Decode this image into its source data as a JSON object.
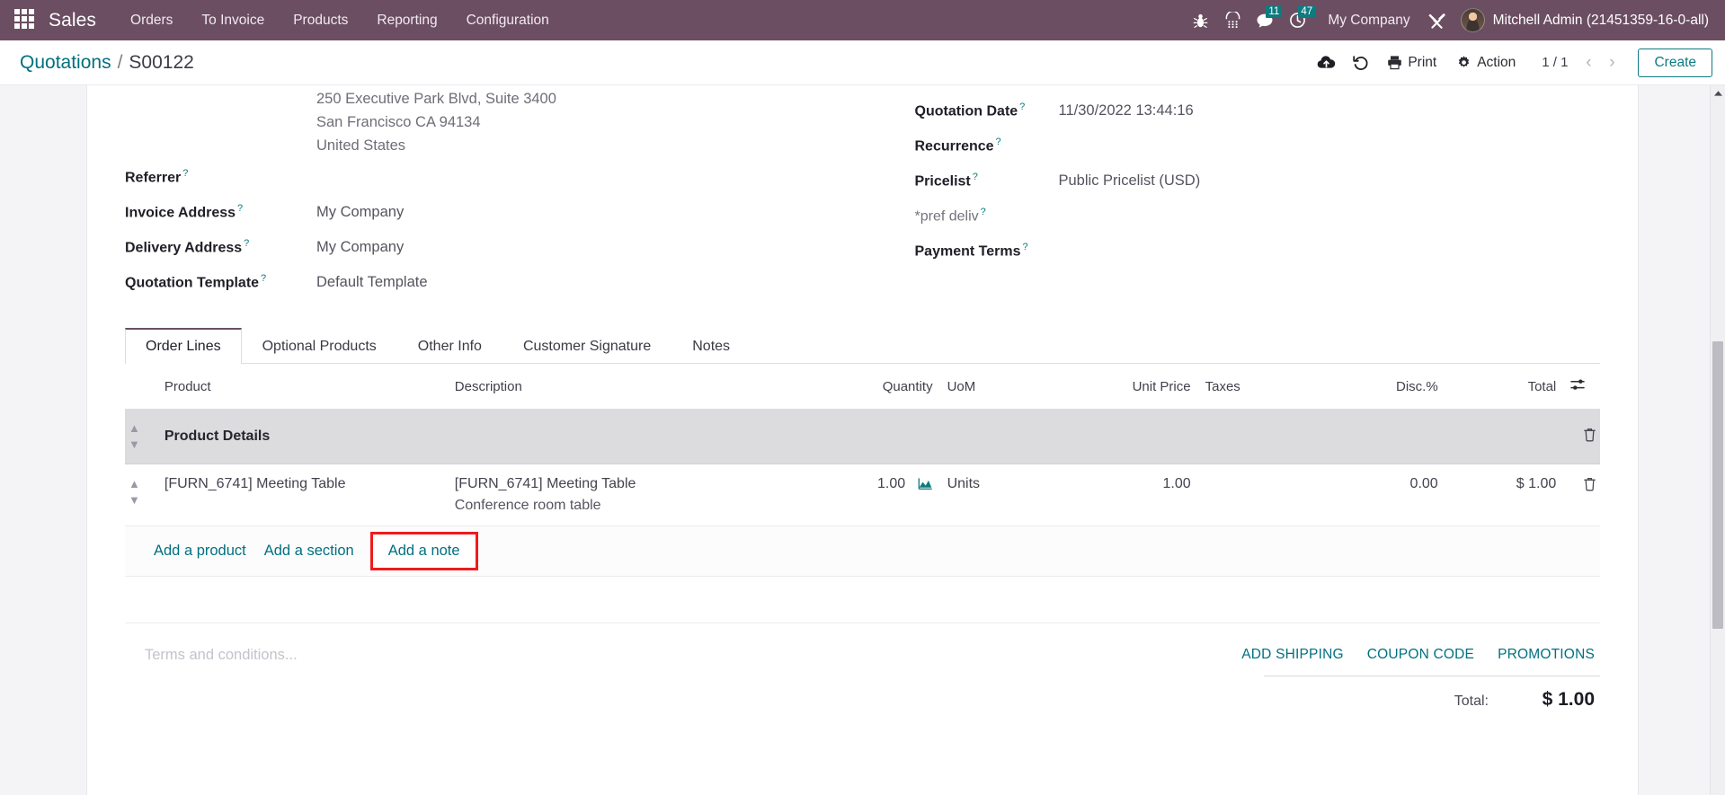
{
  "navbar": {
    "apps_icon": "apps-grid-icon",
    "brand": "Sales",
    "menu": [
      {
        "label": "Orders"
      },
      {
        "label": "To Invoice"
      },
      {
        "label": "Products"
      },
      {
        "label": "Reporting"
      },
      {
        "label": "Configuration"
      }
    ],
    "icons": [
      {
        "name": "bug-icon",
        "badge": null
      },
      {
        "name": "dialpad-icon",
        "badge": null
      },
      {
        "name": "messaging-icon",
        "badge": "11"
      },
      {
        "name": "activities-clock-icon",
        "badge": "47"
      }
    ],
    "company": "My Company",
    "tools_icon": "wrench-screwdriver-icon",
    "avatar_icon": "user-avatar",
    "username": "Mitchell Admin (21451359-16-0-all)",
    "background_color": "#6b4e62",
    "badge_color": "#0d7b80"
  },
  "control_panel": {
    "breadcrumb": {
      "root": "Quotations",
      "separator": "/",
      "current": "S00122"
    },
    "save_icon": "cloud-upload-icon",
    "discard_icon": "undo-icon",
    "print": {
      "label": "Print",
      "icon": "printer-icon"
    },
    "action": {
      "label": "Action",
      "icon": "gear-icon"
    },
    "pager": {
      "count": "1 / 1",
      "prev_icon": "chevron-left-icon",
      "next_icon": "chevron-right-icon"
    },
    "create_label": "Create",
    "accent_color": "#0d7b80"
  },
  "form": {
    "address_lines": [
      "250 Executive Park Blvd, Suite 3400",
      "San Francisco CA 94134",
      "United States"
    ],
    "left_fields": [
      {
        "label": "Referrer",
        "value": "",
        "muted": false
      },
      {
        "label": "Invoice Address",
        "value": "My Company",
        "muted": false
      },
      {
        "label": "Delivery Address",
        "value": "My Company",
        "muted": false
      },
      {
        "label": "Quotation Template",
        "value": "Default Template",
        "muted": false
      }
    ],
    "right_fields": [
      {
        "label": "Quotation Date",
        "value": "11/30/2022 13:44:16",
        "muted": false
      },
      {
        "label": "Recurrence",
        "value": "",
        "muted": false
      },
      {
        "label": "Pricelist",
        "value": "Public Pricelist (USD)",
        "muted": false
      },
      {
        "label": "*pref deliv",
        "value": "",
        "muted": true
      },
      {
        "label": "Payment Terms",
        "value": "",
        "muted": false
      }
    ],
    "tooltip_marker": "?"
  },
  "notebook": {
    "tabs": [
      {
        "label": "Order Lines",
        "active": true
      },
      {
        "label": "Optional Products",
        "active": false
      },
      {
        "label": "Other Info",
        "active": false
      },
      {
        "label": "Customer Signature",
        "active": false
      },
      {
        "label": "Notes",
        "active": false
      }
    ]
  },
  "order_lines": {
    "columns": {
      "product": "Product",
      "description": "Description",
      "quantity": "Quantity",
      "uom": "UoM",
      "unit_price": "Unit Price",
      "taxes": "Taxes",
      "discount": "Disc.%",
      "total": "Total"
    },
    "optional_columns_icon": "column-options-icon",
    "section": {
      "name": "Product Details",
      "handle_icon": "drag-handle-icon",
      "delete_icon": "trash-icon"
    },
    "rows": [
      {
        "product": "[FURN_6741] Meeting Table",
        "description": "[FURN_6741] Meeting Table",
        "description_sub": "Conference room table",
        "quantity": "1.00",
        "quantity_icon": "forecast-chart-icon",
        "uom": "Units",
        "unit_price": "1.00",
        "taxes": "",
        "discount": "0.00",
        "total": "$ 1.00",
        "handle_icon": "drag-handle-icon",
        "delete_icon": "trash-icon"
      }
    ],
    "add_links": [
      {
        "label": "Add a product",
        "highlighted": false
      },
      {
        "label": "Add a section",
        "highlighted": false
      },
      {
        "label": "Add a note",
        "highlighted": true
      }
    ],
    "highlight_color": "#f01b1b"
  },
  "footer": {
    "terms_placeholder": "Terms and conditions...",
    "promo_links": [
      {
        "label": "ADD SHIPPING"
      },
      {
        "label": "COUPON CODE"
      },
      {
        "label": "PROMOTIONS"
      }
    ],
    "total_label": "Total:",
    "total_value": "$ 1.00"
  },
  "scrollbar": {
    "up_arrow_icon": "scroll-up-arrow-icon",
    "thumb_name": "vertical-scroll-thumb"
  }
}
